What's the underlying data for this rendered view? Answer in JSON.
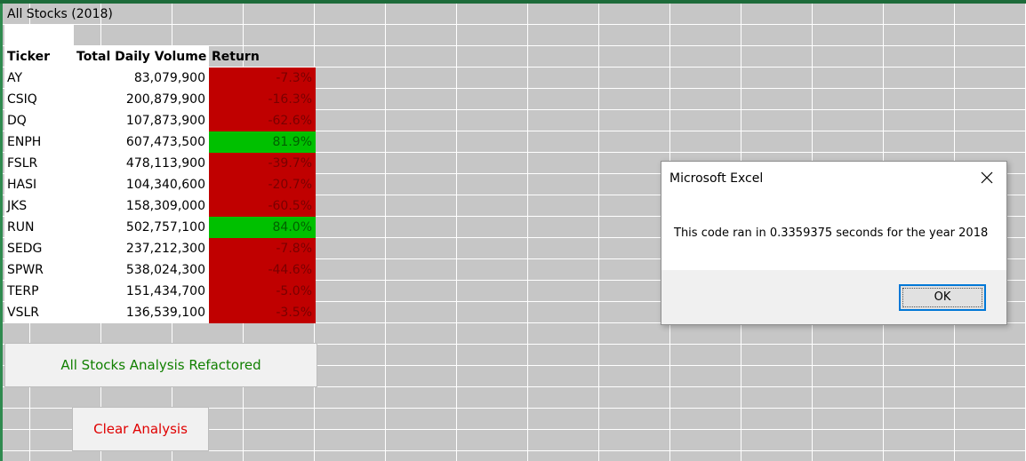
{
  "sheet": {
    "title": "All Stocks (2018)",
    "headers": {
      "ticker": "Ticker",
      "volume": "Total Daily Volume",
      "return": "Return"
    },
    "rows": [
      {
        "ticker": "AY",
        "volume": "83,079,900",
        "return": "-7.3%",
        "status": "negative"
      },
      {
        "ticker": "CSIQ",
        "volume": "200,879,900",
        "return": "-16.3%",
        "status": "negative"
      },
      {
        "ticker": "DQ",
        "volume": "107,873,900",
        "return": "-62.6%",
        "status": "negative"
      },
      {
        "ticker": "ENPH",
        "volume": "607,473,500",
        "return": "81.9%",
        "status": "positive"
      },
      {
        "ticker": "FSLR",
        "volume": "478,113,900",
        "return": "-39.7%",
        "status": "negative"
      },
      {
        "ticker": "HASI",
        "volume": "104,340,600",
        "return": "-20.7%",
        "status": "negative"
      },
      {
        "ticker": "JKS",
        "volume": "158,309,000",
        "return": "-60.5%",
        "status": "negative"
      },
      {
        "ticker": "RUN",
        "volume": "502,757,100",
        "return": "84.0%",
        "status": "positive"
      },
      {
        "ticker": "SEDG",
        "volume": "237,212,300",
        "return": "-7.8%",
        "status": "negative"
      },
      {
        "ticker": "SPWR",
        "volume": "538,024,300",
        "return": "-44.6%",
        "status": "negative"
      },
      {
        "ticker": "TERP",
        "volume": "151,434,700",
        "return": "-5.0%",
        "status": "negative"
      },
      {
        "ticker": "VSLR",
        "volume": "136,539,100",
        "return": "-3.5%",
        "status": "negative"
      }
    ]
  },
  "buttons": {
    "refactor_label": "All Stocks Analysis Refactored",
    "clear_label": "Clear Analysis"
  },
  "dialog": {
    "title": "Microsoft Excel",
    "message": "This code ran in 0.3359375 seconds for the year 2018",
    "ok_label": "OK",
    "close_icon": "close-icon"
  },
  "colors": {
    "positive": "#00c000",
    "negative": "#c00000",
    "refactor_text": "#118000",
    "clear_text": "#e00000",
    "accent": "#0078d7"
  }
}
